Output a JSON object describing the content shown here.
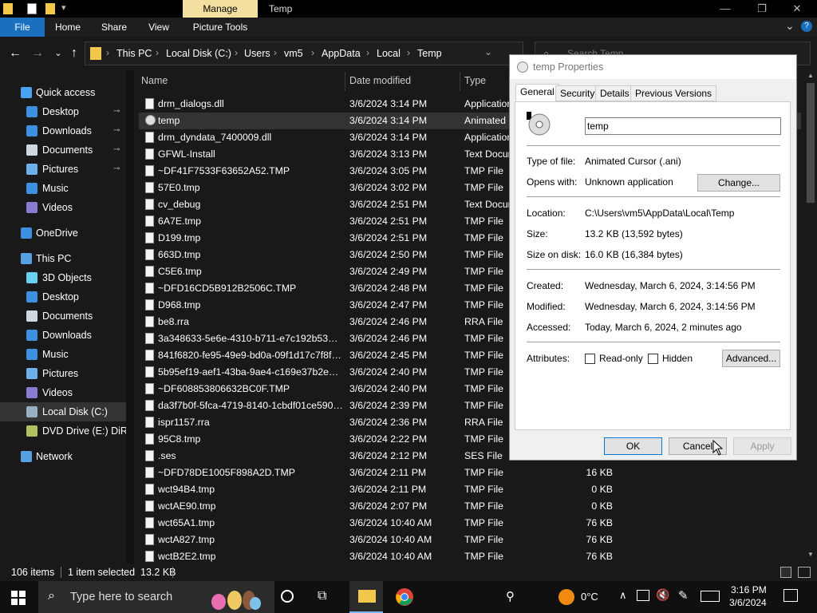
{
  "window": {
    "manage_tab": "Manage",
    "title": "Temp",
    "min_glyph": "—",
    "max_glyph": "❐",
    "close_glyph": "✕"
  },
  "ribbon": {
    "tabs": [
      "File",
      "Home",
      "Share",
      "View",
      "Picture Tools"
    ],
    "collapse_glyph": "⌄",
    "help_glyph": "?"
  },
  "address": {
    "crumbs": [
      "This PC",
      "Local Disk (C:)",
      "Users",
      "vm5",
      "AppData",
      "Local",
      "Temp"
    ],
    "separator": "›",
    "search_placeholder": "Search Temp"
  },
  "sidebar": {
    "items": [
      {
        "label": "Quick access",
        "icon": "star-icon",
        "color": "#4aa3f0",
        "level": 0,
        "pinned": false
      },
      {
        "label": "Desktop",
        "icon": "desktop-icon",
        "color": "#3d8fe0",
        "level": 1,
        "pinned": true
      },
      {
        "label": "Downloads",
        "icon": "download-icon",
        "color": "#3d8fe0",
        "level": 1,
        "pinned": true
      },
      {
        "label": "Documents",
        "icon": "document-icon",
        "color": "#cfd8e0",
        "level": 1,
        "pinned": true
      },
      {
        "label": "Pictures",
        "icon": "pictures-icon",
        "color": "#6bb0e8",
        "level": 1,
        "pinned": true
      },
      {
        "label": "Music",
        "icon": "music-icon",
        "color": "#3d8fe0",
        "level": 1,
        "pinned": false
      },
      {
        "label": "Videos",
        "icon": "video-icon",
        "color": "#8a7bd0",
        "level": 1,
        "pinned": false
      },
      {
        "label": "OneDrive",
        "icon": "cloud-icon",
        "color": "#3d8fe0",
        "level": 0,
        "pinned": false
      },
      {
        "label": "This PC",
        "icon": "computer-icon",
        "color": "#5aa0e0",
        "level": 0,
        "pinned": false
      },
      {
        "label": "3D Objects",
        "icon": "cube-icon",
        "color": "#6ad0f0",
        "level": 1,
        "pinned": false
      },
      {
        "label": "Desktop",
        "icon": "desktop-icon",
        "color": "#3d8fe0",
        "level": 1,
        "pinned": false
      },
      {
        "label": "Documents",
        "icon": "document-icon",
        "color": "#cfd8e0",
        "level": 1,
        "pinned": false
      },
      {
        "label": "Downloads",
        "icon": "download-icon",
        "color": "#3d8fe0",
        "level": 1,
        "pinned": false
      },
      {
        "label": "Music",
        "icon": "music-icon",
        "color": "#3d8fe0",
        "level": 1,
        "pinned": false
      },
      {
        "label": "Pictures",
        "icon": "pictures-icon",
        "color": "#6bb0e8",
        "level": 1,
        "pinned": false
      },
      {
        "label": "Videos",
        "icon": "video-icon",
        "color": "#8a7bd0",
        "level": 1,
        "pinned": false
      },
      {
        "label": "Local Disk (C:)",
        "icon": "drive-icon",
        "color": "#9ab0c0",
        "level": 1,
        "pinned": false
      },
      {
        "label": "DVD Drive (E:) DiRT2",
        "icon": "dvd-icon",
        "color": "#b0c060",
        "level": 1,
        "pinned": false
      },
      {
        "label": "Network",
        "icon": "network-icon",
        "color": "#5aa0e0",
        "level": 0,
        "pinned": false
      }
    ],
    "pin_glyph": "📌"
  },
  "columns": {
    "name": "Name",
    "date": "Date modified",
    "type": "Type"
  },
  "files": [
    {
      "name": "drm_dialogs.dll",
      "date": "3/6/2024 3:14 PM",
      "type": "Application",
      "size": ""
    },
    {
      "name": "temp",
      "date": "3/6/2024 3:14 PM",
      "type": "Animated",
      "size": ""
    },
    {
      "name": "drm_dyndata_7400009.dll",
      "date": "3/6/2024 3:14 PM",
      "type": "Application",
      "size": ""
    },
    {
      "name": "GFWL-Install",
      "date": "3/6/2024 3:13 PM",
      "type": "Text Document",
      "size": ""
    },
    {
      "name": "~DF41F7533F63652A52.TMP",
      "date": "3/6/2024 3:05 PM",
      "type": "TMP File",
      "size": ""
    },
    {
      "name": "57E0.tmp",
      "date": "3/6/2024 3:02 PM",
      "type": "TMP File",
      "size": ""
    },
    {
      "name": "cv_debug",
      "date": "3/6/2024 2:51 PM",
      "type": "Text Document",
      "size": ""
    },
    {
      "name": "6A7E.tmp",
      "date": "3/6/2024 2:51 PM",
      "type": "TMP File",
      "size": ""
    },
    {
      "name": "D199.tmp",
      "date": "3/6/2024 2:51 PM",
      "type": "TMP File",
      "size": ""
    },
    {
      "name": "663D.tmp",
      "date": "3/6/2024 2:50 PM",
      "type": "TMP File",
      "size": ""
    },
    {
      "name": "C5E6.tmp",
      "date": "3/6/2024 2:49 PM",
      "type": "TMP File",
      "size": ""
    },
    {
      "name": "~DFD16CD5B912B2506C.TMP",
      "date": "3/6/2024 2:48 PM",
      "type": "TMP File",
      "size": ""
    },
    {
      "name": "D968.tmp",
      "date": "3/6/2024 2:47 PM",
      "type": "TMP File",
      "size": ""
    },
    {
      "name": "be8.rra",
      "date": "3/6/2024 2:46 PM",
      "type": "RRA File",
      "size": ""
    },
    {
      "name": "3a348633-5e6e-4310-b711-e7c192b53096....",
      "date": "3/6/2024 2:46 PM",
      "type": "TMP File",
      "size": ""
    },
    {
      "name": "841f6820-fe95-49e9-bd0a-09f1d17c7f8f.t...",
      "date": "3/6/2024 2:45 PM",
      "type": "TMP File",
      "size": ""
    },
    {
      "name": "5b95ef19-aef1-43ba-9ae4-c169e37b2ed9....",
      "date": "3/6/2024 2:40 PM",
      "type": "TMP File",
      "size": ""
    },
    {
      "name": "~DF608853806632BC0F.TMP",
      "date": "3/6/2024 2:40 PM",
      "type": "TMP File",
      "size": ""
    },
    {
      "name": "da3f7b0f-5fca-4719-8140-1cbdf01ce590.t...",
      "date": "3/6/2024 2:39 PM",
      "type": "TMP File",
      "size": ""
    },
    {
      "name": "ispr1157.rra",
      "date": "3/6/2024 2:36 PM",
      "type": "RRA File",
      "size": ""
    },
    {
      "name": "95C8.tmp",
      "date": "3/6/2024 2:22 PM",
      "type": "TMP File",
      "size": ""
    },
    {
      "name": ".ses",
      "date": "3/6/2024 2:12 PM",
      "type": "SES File",
      "size": ""
    },
    {
      "name": "~DFD78DE1005F898A2D.TMP",
      "date": "3/6/2024 2:11 PM",
      "type": "TMP File",
      "size": "16 KB"
    },
    {
      "name": "wct94B4.tmp",
      "date": "3/6/2024 2:11 PM",
      "type": "TMP File",
      "size": "0 KB"
    },
    {
      "name": "wctAE90.tmp",
      "date": "3/6/2024 2:07 PM",
      "type": "TMP File",
      "size": "0 KB"
    },
    {
      "name": "wct65A1.tmp",
      "date": "3/6/2024 10:40 AM",
      "type": "TMP File",
      "size": "76 KB"
    },
    {
      "name": "wctA827.tmp",
      "date": "3/6/2024 10:40 AM",
      "type": "TMP File",
      "size": "76 KB"
    },
    {
      "name": "wctB2E2.tmp",
      "date": "3/6/2024 10:40 AM",
      "type": "TMP File",
      "size": "76 KB"
    }
  ],
  "status": {
    "items": "106 items",
    "selected": "1 item selected  13.2 KB"
  },
  "dialog": {
    "title": "temp Properties",
    "tabs": [
      "General",
      "Security",
      "Details",
      "Previous Versions"
    ],
    "filename": "temp",
    "type_label": "Type of file:",
    "type_value": "Animated Cursor (.ani)",
    "opens_label": "Opens with:",
    "opens_value": "Unknown application",
    "change_button": "Change...",
    "location_label": "Location:",
    "location_value": "C:\\Users\\vm5\\AppData\\Local\\Temp",
    "size_label": "Size:",
    "size_value": "13.2 KB (13,592 bytes)",
    "disk_label": "Size on disk:",
    "disk_value": "16.0 KB (16,384 bytes)",
    "created_label": "Created:",
    "created_value": "Wednesday, March 6, 2024, 3:14:56 PM",
    "modified_label": "Modified:",
    "modified_value": "Wednesday, March 6, 2024, 3:14:56 PM",
    "accessed_label": "Accessed:",
    "accessed_value": "Today, March 6, 2024, 2 minutes ago",
    "attributes_label": "Attributes:",
    "readonly_label": "Read-only",
    "hidden_label": "Hidden",
    "advanced_button": "Advanced...",
    "ok_button": "OK",
    "cancel_button": "Cancel",
    "apply_button": "Apply"
  },
  "taskbar": {
    "search_placeholder": "Type here to search",
    "weather": "0°C",
    "time": "3:16 PM",
    "date": "3/6/2024"
  }
}
